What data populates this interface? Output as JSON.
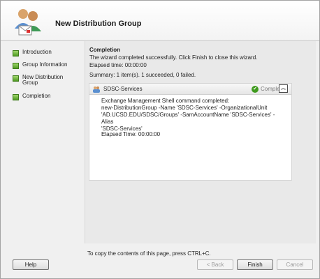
{
  "window": {
    "title": "New Distribution Group",
    "icon": "users-mail-icon"
  },
  "nav": {
    "items": [
      {
        "label": "Introduction"
      },
      {
        "label": "Group Information"
      },
      {
        "label": "New Distribution Group"
      },
      {
        "label": "Completion"
      }
    ],
    "bullet_color": "#6ab83a"
  },
  "content": {
    "section_title": "Completion",
    "message": "The wizard completed successfully. Click Finish to close this wizard.",
    "elapsed": "Elapsed time: 00:00:00",
    "summary": "Summary: 1 item(s). 1 succeeded, 0 failed.",
    "result": {
      "name": "SDSC-Services",
      "status": "Completed",
      "status_icon": "check-icon",
      "collapse_icon": "chevron-up-icon",
      "command_lines": [
        "Exchange Management Shell command completed:",
        "new-DistributionGroup -Name 'SDSC-Services' -OrganizationalUnit",
        "'AD.UCSD.EDU/SDSC/Groups' -SamAccountName 'SDSC-Services' -Alias",
        "'SDSC-Services'"
      ],
      "elapsed": "Elapsed Time: 00:00:00"
    }
  },
  "footer": {
    "copy_hint": "To copy the contents of this page, press CTRL+C.",
    "help": "Help",
    "back": "< Back",
    "finish": "Finish",
    "cancel": "Cancel"
  }
}
